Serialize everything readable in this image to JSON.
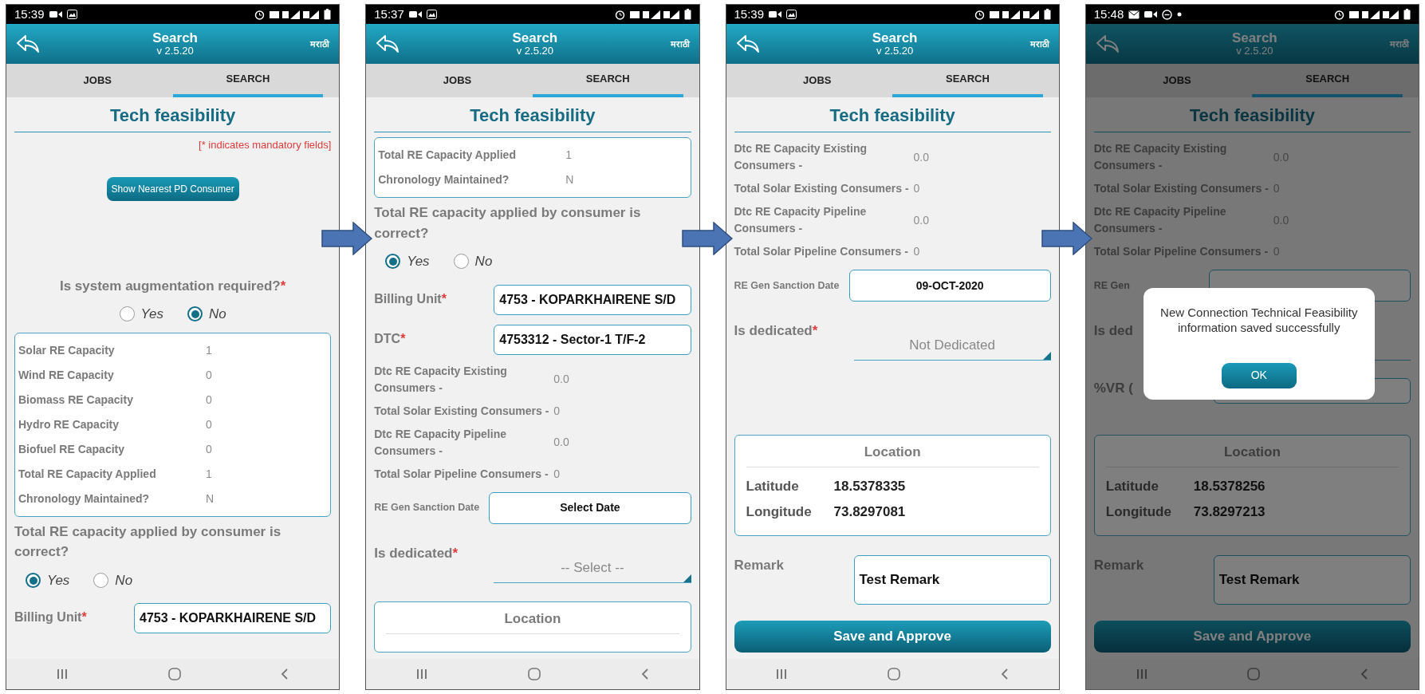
{
  "screens": [
    {
      "status_bar": {
        "time": "15:39",
        "notifications": [
          {
            "kind": "video"
          },
          {
            "kind": "gallery"
          }
        ]
      },
      "header": {
        "title": "Search",
        "version": "v 2.5.20",
        "language": "मराठी"
      },
      "tabs": [
        {
          "label": "JOBS",
          "selected": false
        },
        {
          "label": "SEARCH",
          "selected": true
        }
      ],
      "page_title": "Tech feasibility",
      "items": [
        {
          "kind": "note",
          "text": "[* indicates mandatory fields]"
        },
        {
          "kind": "button",
          "label": "Show Nearest PD Consumer"
        },
        {
          "kind": "radio_question",
          "question": "Is system augmentation required?",
          "required_mark": "*",
          "centered": true,
          "options": [
            {
              "label": "Yes",
              "selected": false
            },
            {
              "label": "No",
              "selected": true
            }
          ]
        },
        {
          "kind": "info_card",
          "rows": [
            {
              "label": "Solar RE Capacity",
              "value": "1"
            },
            {
              "label": "Wind RE Capacity",
              "value": "0"
            },
            {
              "label": "Biomass RE Capacity",
              "value": "0"
            },
            {
              "label": "Hydro RE Capacity",
              "value": "0"
            },
            {
              "label": "Biofuel RE Capacity",
              "value": "0"
            },
            {
              "label": "Total RE Capacity Applied",
              "value": "1"
            },
            {
              "label": "Chronology Maintained?",
              "value": "N"
            }
          ]
        },
        {
          "kind": "radio_question",
          "question": "Total RE capacity applied by consumer is correct?",
          "options": [
            {
              "label": "Yes",
              "selected": true
            },
            {
              "label": "No",
              "selected": false
            }
          ]
        },
        {
          "kind": "select_field",
          "label": "Billing Unit",
          "required_mark": "*",
          "value": "4753 - KOPARKHAIRENE S/D"
        }
      ]
    },
    {
      "status_bar": {
        "time": "15:37",
        "notifications": [
          {
            "kind": "video"
          },
          {
            "kind": "gallery"
          }
        ]
      },
      "header": {
        "title": "Search",
        "version": "v 2.5.20",
        "language": "मराठी"
      },
      "tabs": [
        {
          "label": "JOBS",
          "selected": false
        },
        {
          "label": "SEARCH",
          "selected": true
        }
      ],
      "page_title": "Tech feasibility",
      "items": [
        {
          "kind": "info_card",
          "rows": [
            {
              "label": "Total RE Capacity Applied",
              "value": "1"
            },
            {
              "label": "Chronology Maintained?",
              "value": "N"
            }
          ]
        },
        {
          "kind": "radio_question",
          "question": "Total RE capacity applied by consumer is correct?",
          "options": [
            {
              "label": "Yes",
              "selected": true
            },
            {
              "label": "No",
              "selected": false
            }
          ]
        },
        {
          "kind": "select_field",
          "label": "Billing Unit",
          "required_mark": "*",
          "value": "4753 - KOPARKHAIRENE S/D"
        },
        {
          "kind": "select_field",
          "label": "DTC",
          "required_mark": "*",
          "value": "4753312 - Sector-1 T/F-2"
        },
        {
          "kind": "stat",
          "label": "Dtc RE Capacity Existing Consumers -",
          "value": "0.0"
        },
        {
          "kind": "stat",
          "label": "Total Solar Existing Consumers -",
          "value": "0"
        },
        {
          "kind": "stat",
          "label": "Dtc RE Capacity Pipeline Consumers -",
          "value": "0.0"
        },
        {
          "kind": "stat",
          "label": "Total Solar Pipeline Consumers -",
          "value": "0"
        },
        {
          "kind": "date_field",
          "label": "RE Gen Sanction Date",
          "value": "Select Date"
        },
        {
          "kind": "dropdown",
          "label": "Is dedicated",
          "required_mark": "*",
          "value": "-- Select --"
        },
        {
          "kind": "location_card",
          "title": "Location"
        }
      ]
    },
    {
      "status_bar": {
        "time": "15:39",
        "notifications": [
          {
            "kind": "video"
          },
          {
            "kind": "gallery"
          }
        ]
      },
      "header": {
        "title": "Search",
        "version": "v 2.5.20",
        "language": "मराठी"
      },
      "tabs": [
        {
          "label": "JOBS",
          "selected": false
        },
        {
          "label": "SEARCH",
          "selected": true
        }
      ],
      "page_title": "Tech feasibility",
      "items": [
        {
          "kind": "stat",
          "label": "Dtc RE Capacity Existing Consumers -",
          "value": "0.0"
        },
        {
          "kind": "stat",
          "label": "Total Solar Existing Consumers -",
          "value": "0"
        },
        {
          "kind": "stat",
          "label": "Dtc RE Capacity Pipeline Consumers -",
          "value": "0.0"
        },
        {
          "kind": "stat",
          "label": "Total Solar Pipeline Consumers -",
          "value": "0"
        },
        {
          "kind": "date_field",
          "label": "RE Gen Sanction Date",
          "value": "09-OCT-2020"
        },
        {
          "kind": "dropdown",
          "label": "Is dedicated",
          "required_mark": "*",
          "value": "Not Dedicated"
        },
        {
          "kind": "location_card",
          "title": "Location",
          "rows": [
            {
              "label": "Latitude",
              "value": "18.5378335"
            },
            {
              "label": "Longitude",
              "value": "73.8297081"
            }
          ]
        },
        {
          "kind": "text_field",
          "label": "Remark",
          "value": "Test Remark"
        },
        {
          "kind": "primary_button",
          "label": "Save and Approve"
        }
      ]
    },
    {
      "status_bar": {
        "time": "15:48",
        "notifications": [
          {
            "kind": "mail"
          },
          {
            "kind": "video"
          },
          {
            "kind": "dnd"
          },
          {
            "kind": "dot"
          }
        ]
      },
      "header": {
        "title": "Search",
        "version": "v 2.5.20",
        "language": "मराठी"
      },
      "tabs": [
        {
          "label": "JOBS",
          "selected": false
        },
        {
          "label": "SEARCH",
          "selected": true
        }
      ],
      "page_title": "Tech feasibility",
      "items": [
        {
          "kind": "stat",
          "label": "Dtc RE Capacity Existing Consumers -",
          "value": "0.0"
        },
        {
          "kind": "stat",
          "label": "Total Solar Existing Consumers -",
          "value": "0"
        },
        {
          "kind": "stat",
          "label": "Dtc RE Capacity Pipeline Consumers -",
          "value": "0.0"
        },
        {
          "kind": "stat",
          "label": "Total Solar Pipeline Consumers -",
          "value": "0"
        },
        {
          "kind": "date_field",
          "label": "RE Gen"
        },
        {
          "kind": "dropdown",
          "label": "Is ded"
        },
        {
          "kind": "short_field",
          "label": "%VR ("
        },
        {
          "kind": "location_card",
          "title": "Location",
          "rows": [
            {
              "label": "Latitude",
              "value": "18.5378256"
            },
            {
              "label": "Longitude",
              "value": "73.8297213"
            }
          ]
        },
        {
          "kind": "text_field",
          "label": "Remark",
          "value": "Test Remark"
        },
        {
          "kind": "primary_button",
          "label": "Save and Approve"
        }
      ],
      "dialog": {
        "message": "New Connection Technical Feasibility information saved successfully",
        "button": "OK"
      }
    }
  ]
}
